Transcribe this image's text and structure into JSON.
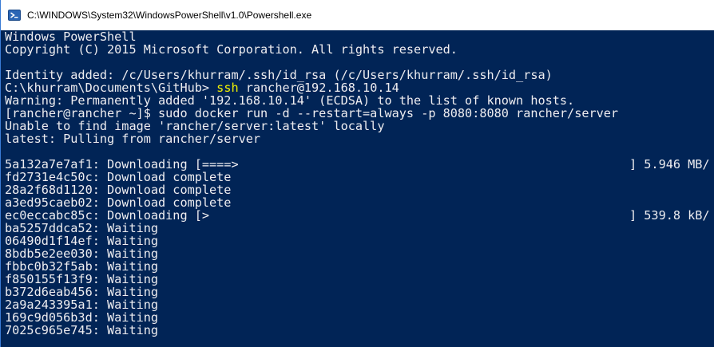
{
  "window": {
    "title": "C:\\WINDOWS\\System32\\WindowsPowerShell\\v1.0\\Powershell.exe",
    "icon": "powershell-icon"
  },
  "colors": {
    "console_bg": "#012456",
    "console_fg": "#eeedf0",
    "command_highlight": "#f4f400"
  },
  "console": {
    "banner_title": "Windows PowerShell",
    "banner_copyright": "Copyright (C) 2015 Microsoft Corporation. All rights reserved.",
    "identity_added": "Identity added: /c/Users/khurram/.ssh/id_rsa (/c/Users/khurram/.ssh/id_rsa)",
    "prompt": "C:\\khurram\\Documents\\GitHub> ",
    "command_name": "ssh",
    "command_args": " rancher@192.168.10.14",
    "warning": "Warning: Permanently added '192.168.10.14' (ECDSA) to the list of known hosts.",
    "remote_command": "[rancher@rancher ~]$ sudo docker run -d --restart=always -p 8080:8080 rancher/server",
    "unable_to_find": "Unable to find image 'rancher/server:latest' locally",
    "pulling": "latest: Pulling from rancher/server",
    "layers": [
      {
        "text": "5a132a7e7af1: Downloading [====>",
        "progress": "] 5.946 MB/"
      },
      {
        "text": "fd2731e4c50c: Download complete",
        "progress": ""
      },
      {
        "text": "28a2f68d1120: Download complete",
        "progress": ""
      },
      {
        "text": "a3ed95caeb02: Download complete",
        "progress": ""
      },
      {
        "text": "ec0eccabc85c: Downloading [>",
        "progress": "] 539.8 kB/"
      },
      {
        "text": "ba5257ddca52: Waiting",
        "progress": ""
      },
      {
        "text": "06490d1f14ef: Waiting",
        "progress": ""
      },
      {
        "text": "8bdb5e2ee030: Waiting",
        "progress": ""
      },
      {
        "text": "fbbc0b32f5ab: Waiting",
        "progress": ""
      },
      {
        "text": "f850155f13f9: Waiting",
        "progress": ""
      },
      {
        "text": "b372d6eab456: Waiting",
        "progress": ""
      },
      {
        "text": "2a9a243395a1: Waiting",
        "progress": ""
      },
      {
        "text": "169c9d056b3d: Waiting",
        "progress": ""
      },
      {
        "text": "7025c965e745: Waiting",
        "progress": ""
      }
    ]
  }
}
